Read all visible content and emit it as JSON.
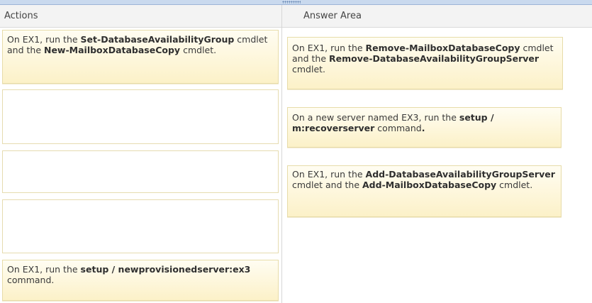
{
  "actions_header": "Actions",
  "answer_header": "Answer Area",
  "actions": [
    {
      "p1": "On EX1, run the ",
      "b1": "Set-DatabaseAvailabilityGroup",
      "p2": " cmdlet and the ",
      "b2": "New-MailboxDatabaseCopy",
      "p3": " cmdlet."
    },
    {
      "p1": "On EX1, run the ",
      "b1": "setup / newprovisionedserver:ex3",
      "p2": " command."
    }
  ],
  "answers": [
    {
      "p1": "On EX1, run the ",
      "b1": "Remove-MailboxDatabaseCopy",
      "p2": " cmdlet and the ",
      "b2": "Remove-DatabaseAvailabilityGroupServer",
      "p3": " cmdlet."
    },
    {
      "p1": "On a new server named EX3, run the ",
      "b1": "setup / m:recoverserver",
      "p2": " command",
      "b2": "."
    },
    {
      "p1": "On EX1, run the ",
      "b1": "Add-DatabaseAvailabilityGroupServer",
      "p2": " cmdlet and the ",
      "b2": "Add-MailboxDatabaseCopy",
      "p3": " cmdlet."
    }
  ]
}
